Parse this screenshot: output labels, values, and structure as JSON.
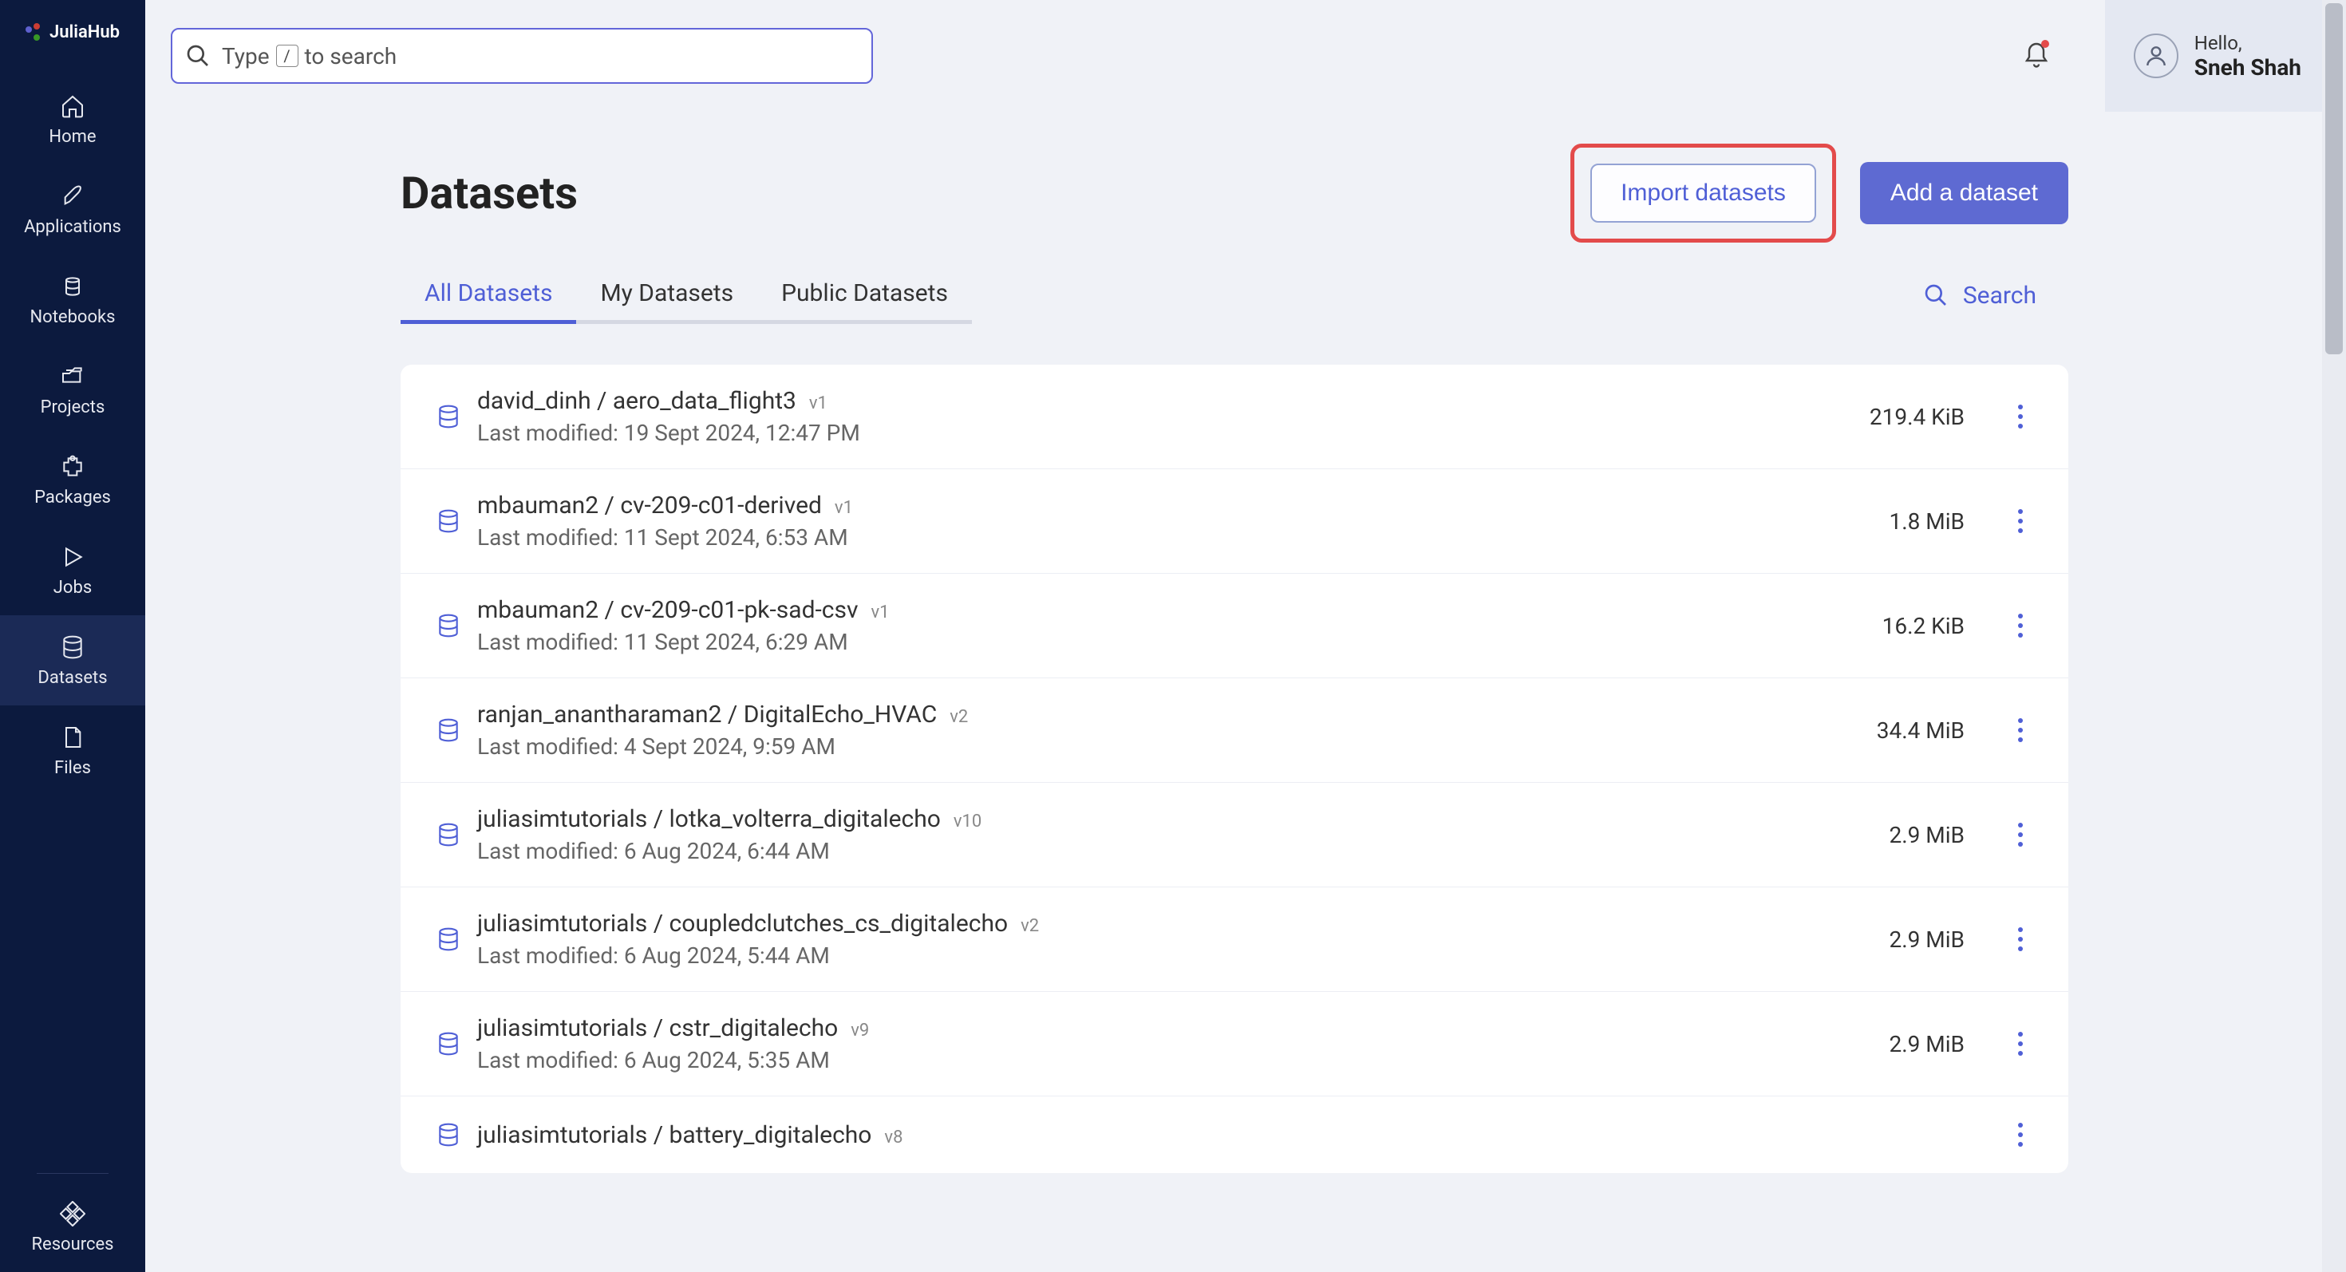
{
  "brand": "JuliaHub",
  "sidebar": {
    "items": [
      {
        "label": "Home"
      },
      {
        "label": "Applications"
      },
      {
        "label": "Notebooks"
      },
      {
        "label": "Projects"
      },
      {
        "label": "Packages"
      },
      {
        "label": "Jobs"
      },
      {
        "label": "Datasets"
      },
      {
        "label": "Files"
      }
    ],
    "footer_label": "Resources",
    "active_index": 6
  },
  "topbar": {
    "search_prefix": "Type",
    "search_key": "/",
    "search_suffix": "to search",
    "user_hello": "Hello,",
    "user_name": "Sneh Shah"
  },
  "page": {
    "title": "Datasets",
    "import_label": "Import datasets",
    "add_label": "Add a dataset"
  },
  "tabs": {
    "items": [
      {
        "label": "All Datasets"
      },
      {
        "label": "My Datasets"
      },
      {
        "label": "Public Datasets"
      }
    ],
    "active_index": 0,
    "search_label": "Search"
  },
  "datasets": [
    {
      "title": "david_dinh / aero_data_flight3",
      "version": "v1",
      "modified": "Last modified: 19 Sept 2024, 12:47 PM",
      "size": "219.4 KiB"
    },
    {
      "title": "mbauman2 / cv-209-c01-derived",
      "version": "v1",
      "modified": "Last modified: 11 Sept 2024, 6:53 AM",
      "size": "1.8 MiB"
    },
    {
      "title": "mbauman2 / cv-209-c01-pk-sad-csv",
      "version": "v1",
      "modified": "Last modified: 11 Sept 2024, 6:29 AM",
      "size": "16.2 KiB"
    },
    {
      "title": "ranjan_anantharaman2 / DigitalEcho_HVAC",
      "version": "v2",
      "modified": "Last modified: 4 Sept 2024, 9:59 AM",
      "size": "34.4 MiB"
    },
    {
      "title": "juliasimtutorials / lotka_volterra_digitalecho",
      "version": "v10",
      "modified": "Last modified: 6 Aug 2024, 6:44 AM",
      "size": "2.9 MiB"
    },
    {
      "title": "juliasimtutorials / coupledclutches_cs_digitalecho",
      "version": "v2",
      "modified": "Last modified: 6 Aug 2024, 5:44 AM",
      "size": "2.9 MiB"
    },
    {
      "title": "juliasimtutorials / cstr_digitalecho",
      "version": "v9",
      "modified": "Last modified: 6 Aug 2024, 5:35 AM",
      "size": "2.9 MiB"
    },
    {
      "title": "juliasimtutorials / battery_digitalecho",
      "version": "v8",
      "modified": "",
      "size": ""
    }
  ]
}
